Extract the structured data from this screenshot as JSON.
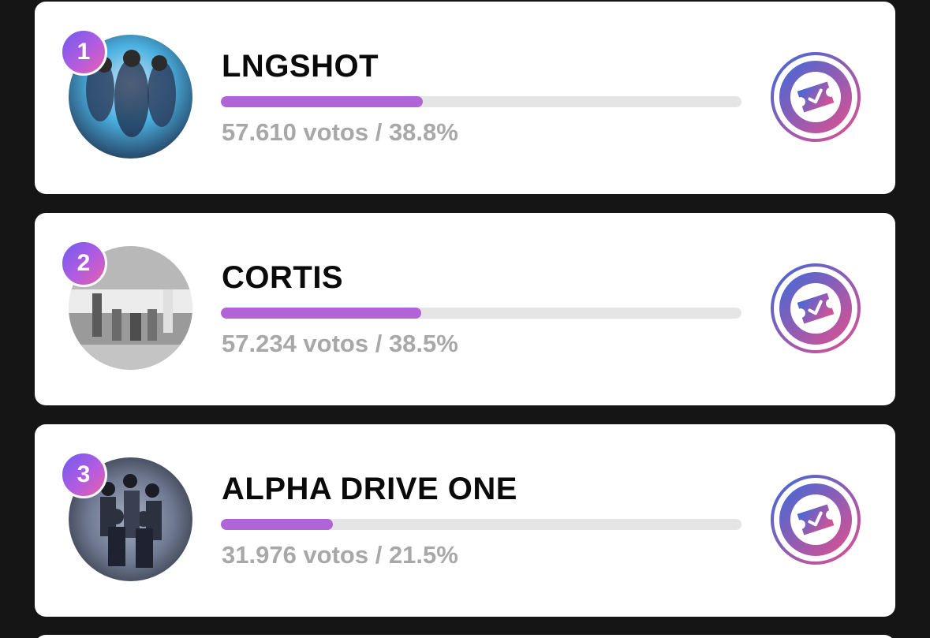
{
  "candidates": [
    {
      "rank": "1",
      "name": "LNGSHOT",
      "votes_text": "57.610 votos / 38.8%",
      "share": 0.388,
      "avatar_palette": [
        "#2a3a5a",
        "#4ab0e0",
        "#1b2440",
        "#cfe9f7"
      ]
    },
    {
      "rank": "2",
      "name": "CORTIS",
      "votes_text": "57.234 votos / 38.5%",
      "share": 0.385,
      "avatar_palette": [
        "#c9c9c9",
        "#8a8a8a",
        "#e8e8e8",
        "#5a5a5a"
      ]
    },
    {
      "rank": "3",
      "name": "ALPHA DRIVE ONE",
      "votes_text": "31.976 votos / 21.5%",
      "share": 0.215,
      "avatar_palette": [
        "#2c3140",
        "#6e7890",
        "#1a1d26",
        "#a7b0c2"
      ]
    }
  ],
  "colors": {
    "background": "#151515",
    "card": "#ffffff",
    "bar_track": "#e5e5e5",
    "bar_fill": "#b164d6",
    "vote_text": "#a8a8a8",
    "accent_start": "#3f6ad8",
    "accent_end": "#e0508f"
  },
  "icons": {
    "rank_badge": "rank-badge-icon",
    "vote_button": "vote-ticket-icon"
  }
}
